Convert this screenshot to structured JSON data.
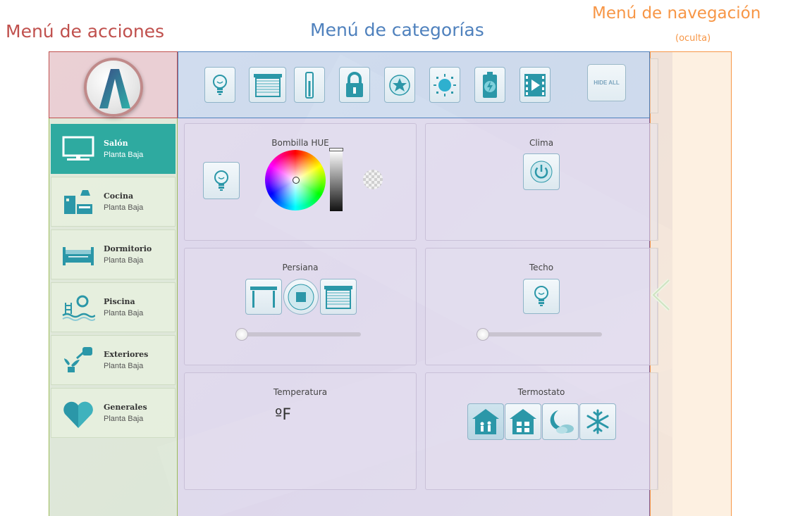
{
  "headings": {
    "actions": "Menú de acciones",
    "categories": "Menú de categorías",
    "nav": "Menú de navegación",
    "nav_sub": "(oculta)"
  },
  "colors": {
    "actions": "#c0504d",
    "categories": "#4f81bd",
    "nav": "#f79646",
    "accent": "#2eaaa0"
  },
  "category_bar": {
    "icons": [
      "lightbulb-icon",
      "blind-icon",
      "thermometer-icon",
      "lock-icon",
      "star-icon",
      "sun-icon",
      "battery-icon",
      "media-icon"
    ],
    "hide_all_label": "HIDE ALL"
  },
  "rooms": [
    {
      "name": "Salón",
      "floor": "Planta Baja",
      "icon": "tv-icon",
      "active": true
    },
    {
      "name": "Cocina",
      "floor": "Planta Baja",
      "icon": "kitchen-icon",
      "active": false
    },
    {
      "name": "Dormitorio",
      "floor": "Planta Baja",
      "icon": "bed-icon",
      "active": false
    },
    {
      "name": "Piscina",
      "floor": "Planta Baja",
      "icon": "pool-icon",
      "active": false
    },
    {
      "name": "Exteriores",
      "floor": "Planta Baja",
      "icon": "watering-can-icon",
      "active": false
    },
    {
      "name": "Generales",
      "floor": "Planta Baja",
      "icon": "heart-icon",
      "active": false
    }
  ],
  "devices": {
    "hue": {
      "title": "Bombilla HUE"
    },
    "clima": {
      "title": "Clima"
    },
    "persiana": {
      "title": "Persiana",
      "level": 0
    },
    "techo": {
      "title": "Techo",
      "level": 0
    },
    "temperatura": {
      "title": "Temperatura",
      "value": "ºF"
    },
    "termostato": {
      "title": "Termostato",
      "modes": [
        "comfort-mode-icon",
        "economy-mode-icon",
        "night-mode-icon",
        "antifreeze-mode-icon"
      ]
    }
  }
}
